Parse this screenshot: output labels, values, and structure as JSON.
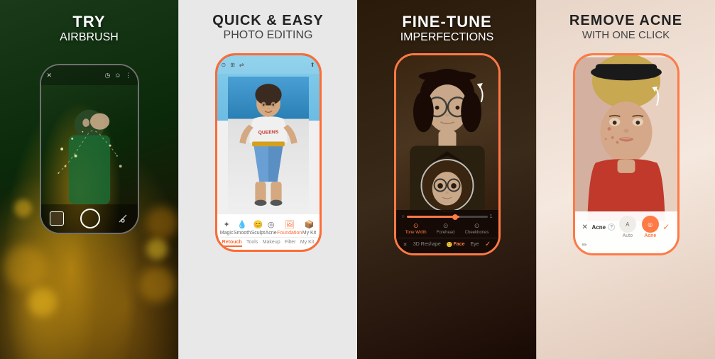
{
  "panels": [
    {
      "id": "panel-1",
      "title_main": "TRY",
      "title_sub": "AIRBRUSH",
      "bg_color_start": "#3a2a10",
      "bg_color_end": "#6b4c1a",
      "phone_border": "rgba(255,255,255,0.45)",
      "toolbar_icons": [
        "✕",
        "🕐",
        "😊",
        "⋮"
      ]
    },
    {
      "id": "panel-2",
      "title_main": "QUICK & EASY",
      "title_sub": "PHOTO EDITING",
      "bg_color_start": "#e8e8e8",
      "bg_color_end": "#d0d0d0",
      "phone_border": "#ff6b35",
      "toolbar_tabs": [
        "Retouch",
        "Tools",
        "Makeup",
        "Filter",
        "My Kit"
      ],
      "toolbar_icons": [
        "✦",
        "💧",
        "😊",
        "✦",
        "🖼",
        "📦"
      ],
      "toolbar_labels": [
        "Magic",
        "Smooth",
        "Sculpt",
        "Acne",
        "Foundation",
        "My Kit"
      ],
      "active_tab": "Retouch"
    },
    {
      "id": "panel-3",
      "title_main": "FINE-TUNE",
      "title_sub": "IMPERFECTIONS",
      "phone_border": "#ff7a45",
      "face_tabs": [
        "Tone Width",
        "Forehead",
        "Cheekbones"
      ],
      "bottom_tabs": [
        "3D Reshape",
        "Face",
        "Eye",
        "✓"
      ],
      "slider_value": 65
    },
    {
      "id": "panel-4",
      "title_main": "REMOVE ACNE",
      "title_sub": "WITH ONE CLICK",
      "phone_border": "#ff7a45",
      "bottom_label": "Acne",
      "bottom_sublabel": "?",
      "bottom_options": [
        "Auto",
        "Acne"
      ],
      "active_option": "Acne"
    }
  ],
  "brand_color": "#ff7a45",
  "accent_color": "#ff6b35"
}
